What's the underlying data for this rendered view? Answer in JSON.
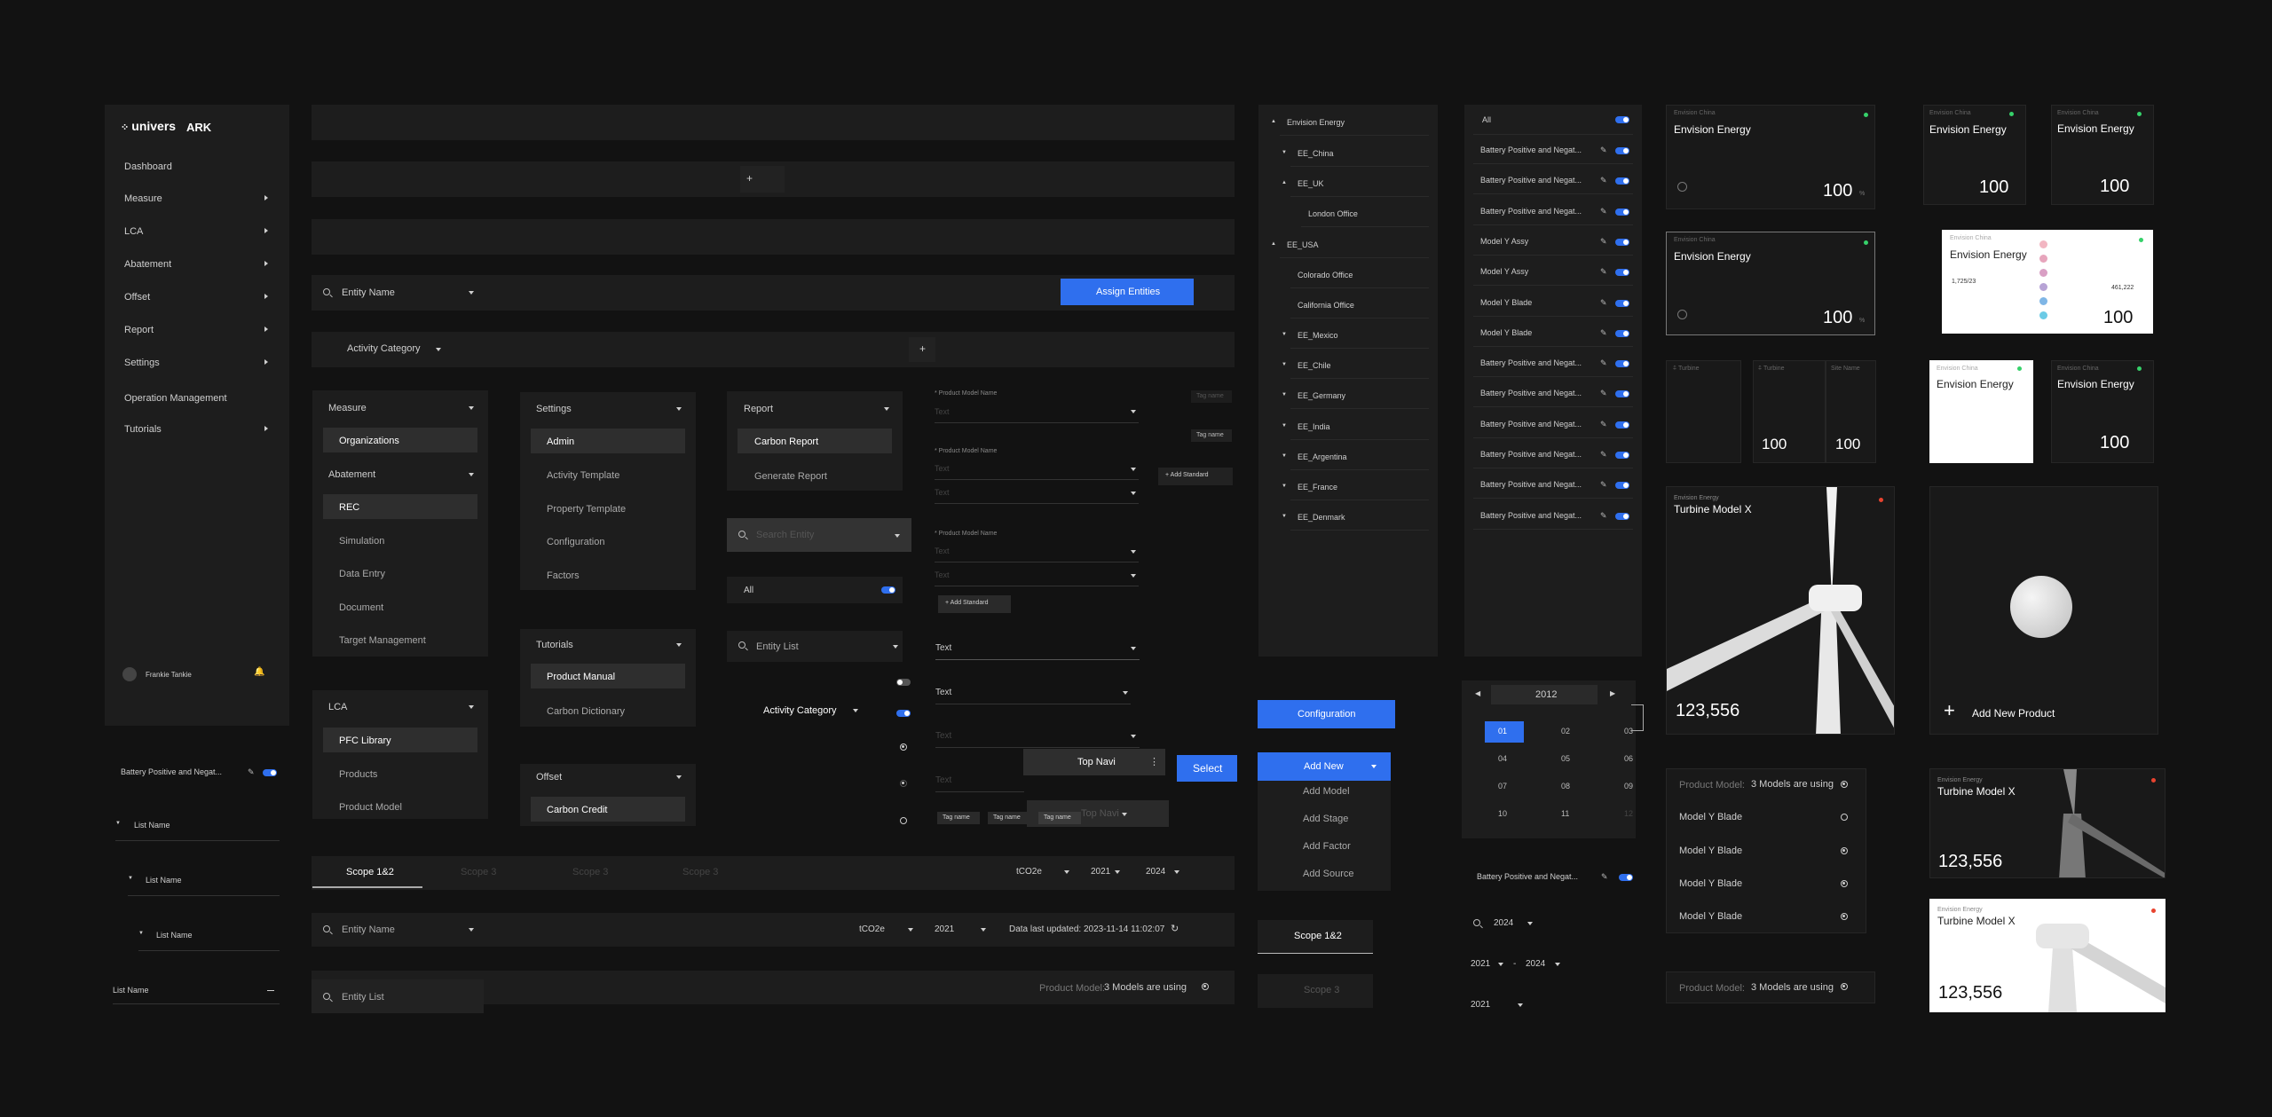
{
  "sidebar": {
    "logo": "univers",
    "app": "ARK",
    "items": [
      "Dashboard",
      "Measure",
      "LCA",
      "Abatement",
      "Offset",
      "Report",
      "Settings",
      "Operation Management",
      "Tutorials"
    ],
    "user": "Frankie Tankie"
  },
  "list": {
    "battery": "Battery Positive and Negat...",
    "items": [
      "List Name",
      "List Name",
      "List Name",
      "List Name"
    ]
  },
  "bars": {
    "plus": "+",
    "entity": "Entity Name",
    "assign": "Assign Entities",
    "category": "Activity Category",
    "plus2": "+"
  },
  "menus": {
    "measure": {
      "title": "Measure",
      "items": [
        "Organizations"
      ]
    },
    "abatement": {
      "title": "Abatement",
      "items": [
        "REC",
        "Simulation",
        "Data Entry",
        "Document",
        "Target Management"
      ]
    },
    "lca": {
      "title": "LCA",
      "items": [
        "PFC Library",
        "Products",
        "Product Model"
      ]
    },
    "settings": {
      "title": "Settings",
      "items": [
        "Admin",
        "Activity Template",
        "Property Template",
        "Configuration",
        "Factors"
      ]
    },
    "tutorials": {
      "title": "Tutorials",
      "items": [
        "Product Manual",
        "Carbon Dictionary"
      ]
    },
    "offset": {
      "title": "Offset",
      "items": [
        "Carbon Credit"
      ]
    },
    "report": {
      "title": "Report",
      "items": [
        "Carbon Report",
        "Generate Report"
      ]
    }
  },
  "search": {
    "placeholder": "Search Entity",
    "all": "All",
    "entity_list": "Entity List",
    "activity": "Activity Category"
  },
  "form": {
    "label": "* Product Model Name",
    "text": "Text",
    "tag": "Tag name",
    "add_standard": "Add Standard",
    "top_navi": "Top Navi",
    "select": "Select"
  },
  "scope": {
    "tabs": [
      "Scope 1&2",
      "Scope 3",
      "Scope 3",
      "Scope 3"
    ],
    "unit": "tCO2e",
    "y1": "2021",
    "y2": "2024"
  },
  "filter": {
    "entity": "Entity Name",
    "unit": "tCO2e",
    "year": "2021",
    "updated": "Data last updated: 2023-11-14 11:02:07",
    "entity_list": "Entity List",
    "pm_label": "Product Model:",
    "pm_value": "3 Models are using"
  },
  "tree": [
    "Envision Energy",
    "EE_China",
    "EE_UK",
    "London Office",
    "EE_USA",
    "Colorado Office",
    "California Office",
    "EE_Mexico",
    "EE_Chile",
    "EE_Germany",
    "EE_India",
    "EE_Argentina",
    "EE_France",
    "EE_Denmark"
  ],
  "config": {
    "configuration": "Configuration",
    "add_new": "Add New",
    "items": [
      "Add Model",
      "Add Stage",
      "Add Factor",
      "Add Source"
    ],
    "scope_a": "Scope 1&2",
    "scope_b": "Scope 3"
  },
  "toggles": {
    "all": "All",
    "rows": [
      "Battery Positive and Negat...",
      "Battery Positive and Negat...",
      "Battery Positive and Negat...",
      "Model Y Assy",
      "Model Y Assy",
      "Model Y Blade",
      "Model Y Blade",
      "Battery Positive and Negat...",
      "Battery Positive and Negat...",
      "Battery Positive and Negat...",
      "Battery Positive and Negat...",
      "Battery Positive and Negat...",
      "Battery Positive and Negat..."
    ]
  },
  "calendar": {
    "year": "2012",
    "months": [
      "01",
      "02",
      "03",
      "04",
      "05",
      "06",
      "07",
      "08",
      "09",
      "10",
      "11",
      "12"
    ],
    "battery": "Battery Positive and Negat...",
    "y2024": "2024",
    "range_a": "2021",
    "range_sep": "-",
    "range_b": "2024",
    "y2021": "2021"
  },
  "cards": {
    "sub": "Envision China",
    "title": "Envision Energy",
    "value": "100",
    "unit": "%",
    "turbine": "Turbine",
    "site": "Site Name",
    "ee_sub": "Envision Energy",
    "turbine_title": "Turbine Model X",
    "turbine_val": "123,556",
    "add": "Add New Product",
    "emb_a": "1,725/23",
    "emb_b": "461,222"
  },
  "models": {
    "label": "Product Model:",
    "value": "3 Models are using",
    "items": [
      "Model Y Blade",
      "Model Y Blade",
      "Model Y Blade",
      "Model Y Blade"
    ]
  },
  "colors": {
    "accent": "#2f6fee",
    "bg": "#121212",
    "panel": "#1d1d1d",
    "green": "#36d16a",
    "red": "#e8432f"
  }
}
